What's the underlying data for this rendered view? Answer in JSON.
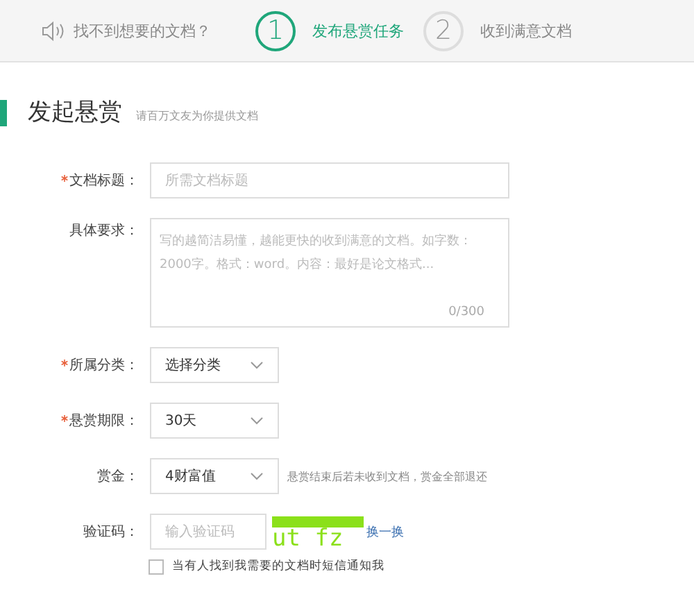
{
  "header": {
    "notice": "找不到想要的文档？",
    "steps": [
      {
        "number": "1",
        "label": "发布悬赏任务",
        "selected": true
      },
      {
        "number": "2",
        "label": "收到满意文档",
        "selected": false
      }
    ]
  },
  "section": {
    "title": "发起悬赏",
    "subtitle": "请百万文友为你提供文档"
  },
  "fields": [
    {
      "kind": "text",
      "label": "文档标题：",
      "required": true,
      "placeholder": "所需文档标题"
    },
    {
      "kind": "textarea",
      "label": "具体要求：",
      "required": false,
      "placeholder": "写的越简洁易懂，越能更快的收到满意的文档。如字数：2000字。格式：word。内容：最好是论文格式...",
      "counter": "0/300"
    },
    {
      "kind": "select",
      "label": "所属分类：",
      "required": true,
      "value": "选择分类"
    },
    {
      "kind": "select",
      "label": "悬赏期限：",
      "required": true,
      "value": "30天"
    },
    {
      "kind": "select",
      "label": "赏金：",
      "required": false,
      "value": "4财富值",
      "hint": "悬赏结束后若未收到文档，赏金全部退还"
    },
    {
      "kind": "captcha",
      "label": "验证码：",
      "required": false,
      "placeholder": "输入验证码",
      "captcha": "ut fz",
      "refresh": "换一换"
    }
  ],
  "notify": {
    "label": "当有人找到我需要的文档时短信通知我",
    "checked": false
  }
}
